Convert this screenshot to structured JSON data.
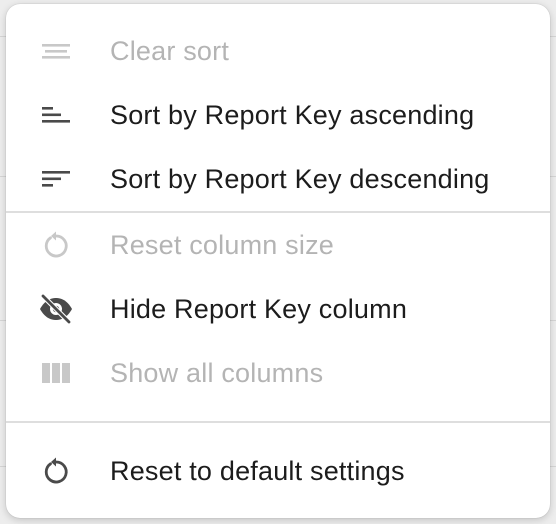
{
  "menu": {
    "items": [
      {
        "label": "Clear sort",
        "icon": "clear-sort-icon",
        "enabled": false
      },
      {
        "label": "Sort by Report Key ascending",
        "icon": "sort-ascending-icon",
        "enabled": true
      },
      {
        "label": "Sort by Report Key descending",
        "icon": "sort-descending-icon",
        "enabled": true
      },
      {
        "label": "Reset column size",
        "icon": "reset-icon",
        "enabled": false
      },
      {
        "label": "Hide Report Key column",
        "icon": "eye-off-icon",
        "enabled": true
      },
      {
        "label": "Show all columns",
        "icon": "columns-icon",
        "enabled": false
      },
      {
        "label": "Reset to default settings",
        "icon": "reset-icon",
        "enabled": true
      }
    ]
  },
  "colors": {
    "enabled_text": "#1c1c1c",
    "disabled_text": "#b4b4b4",
    "enabled_icon": "#4a4a4a",
    "disabled_icon": "#c8c8c8"
  }
}
